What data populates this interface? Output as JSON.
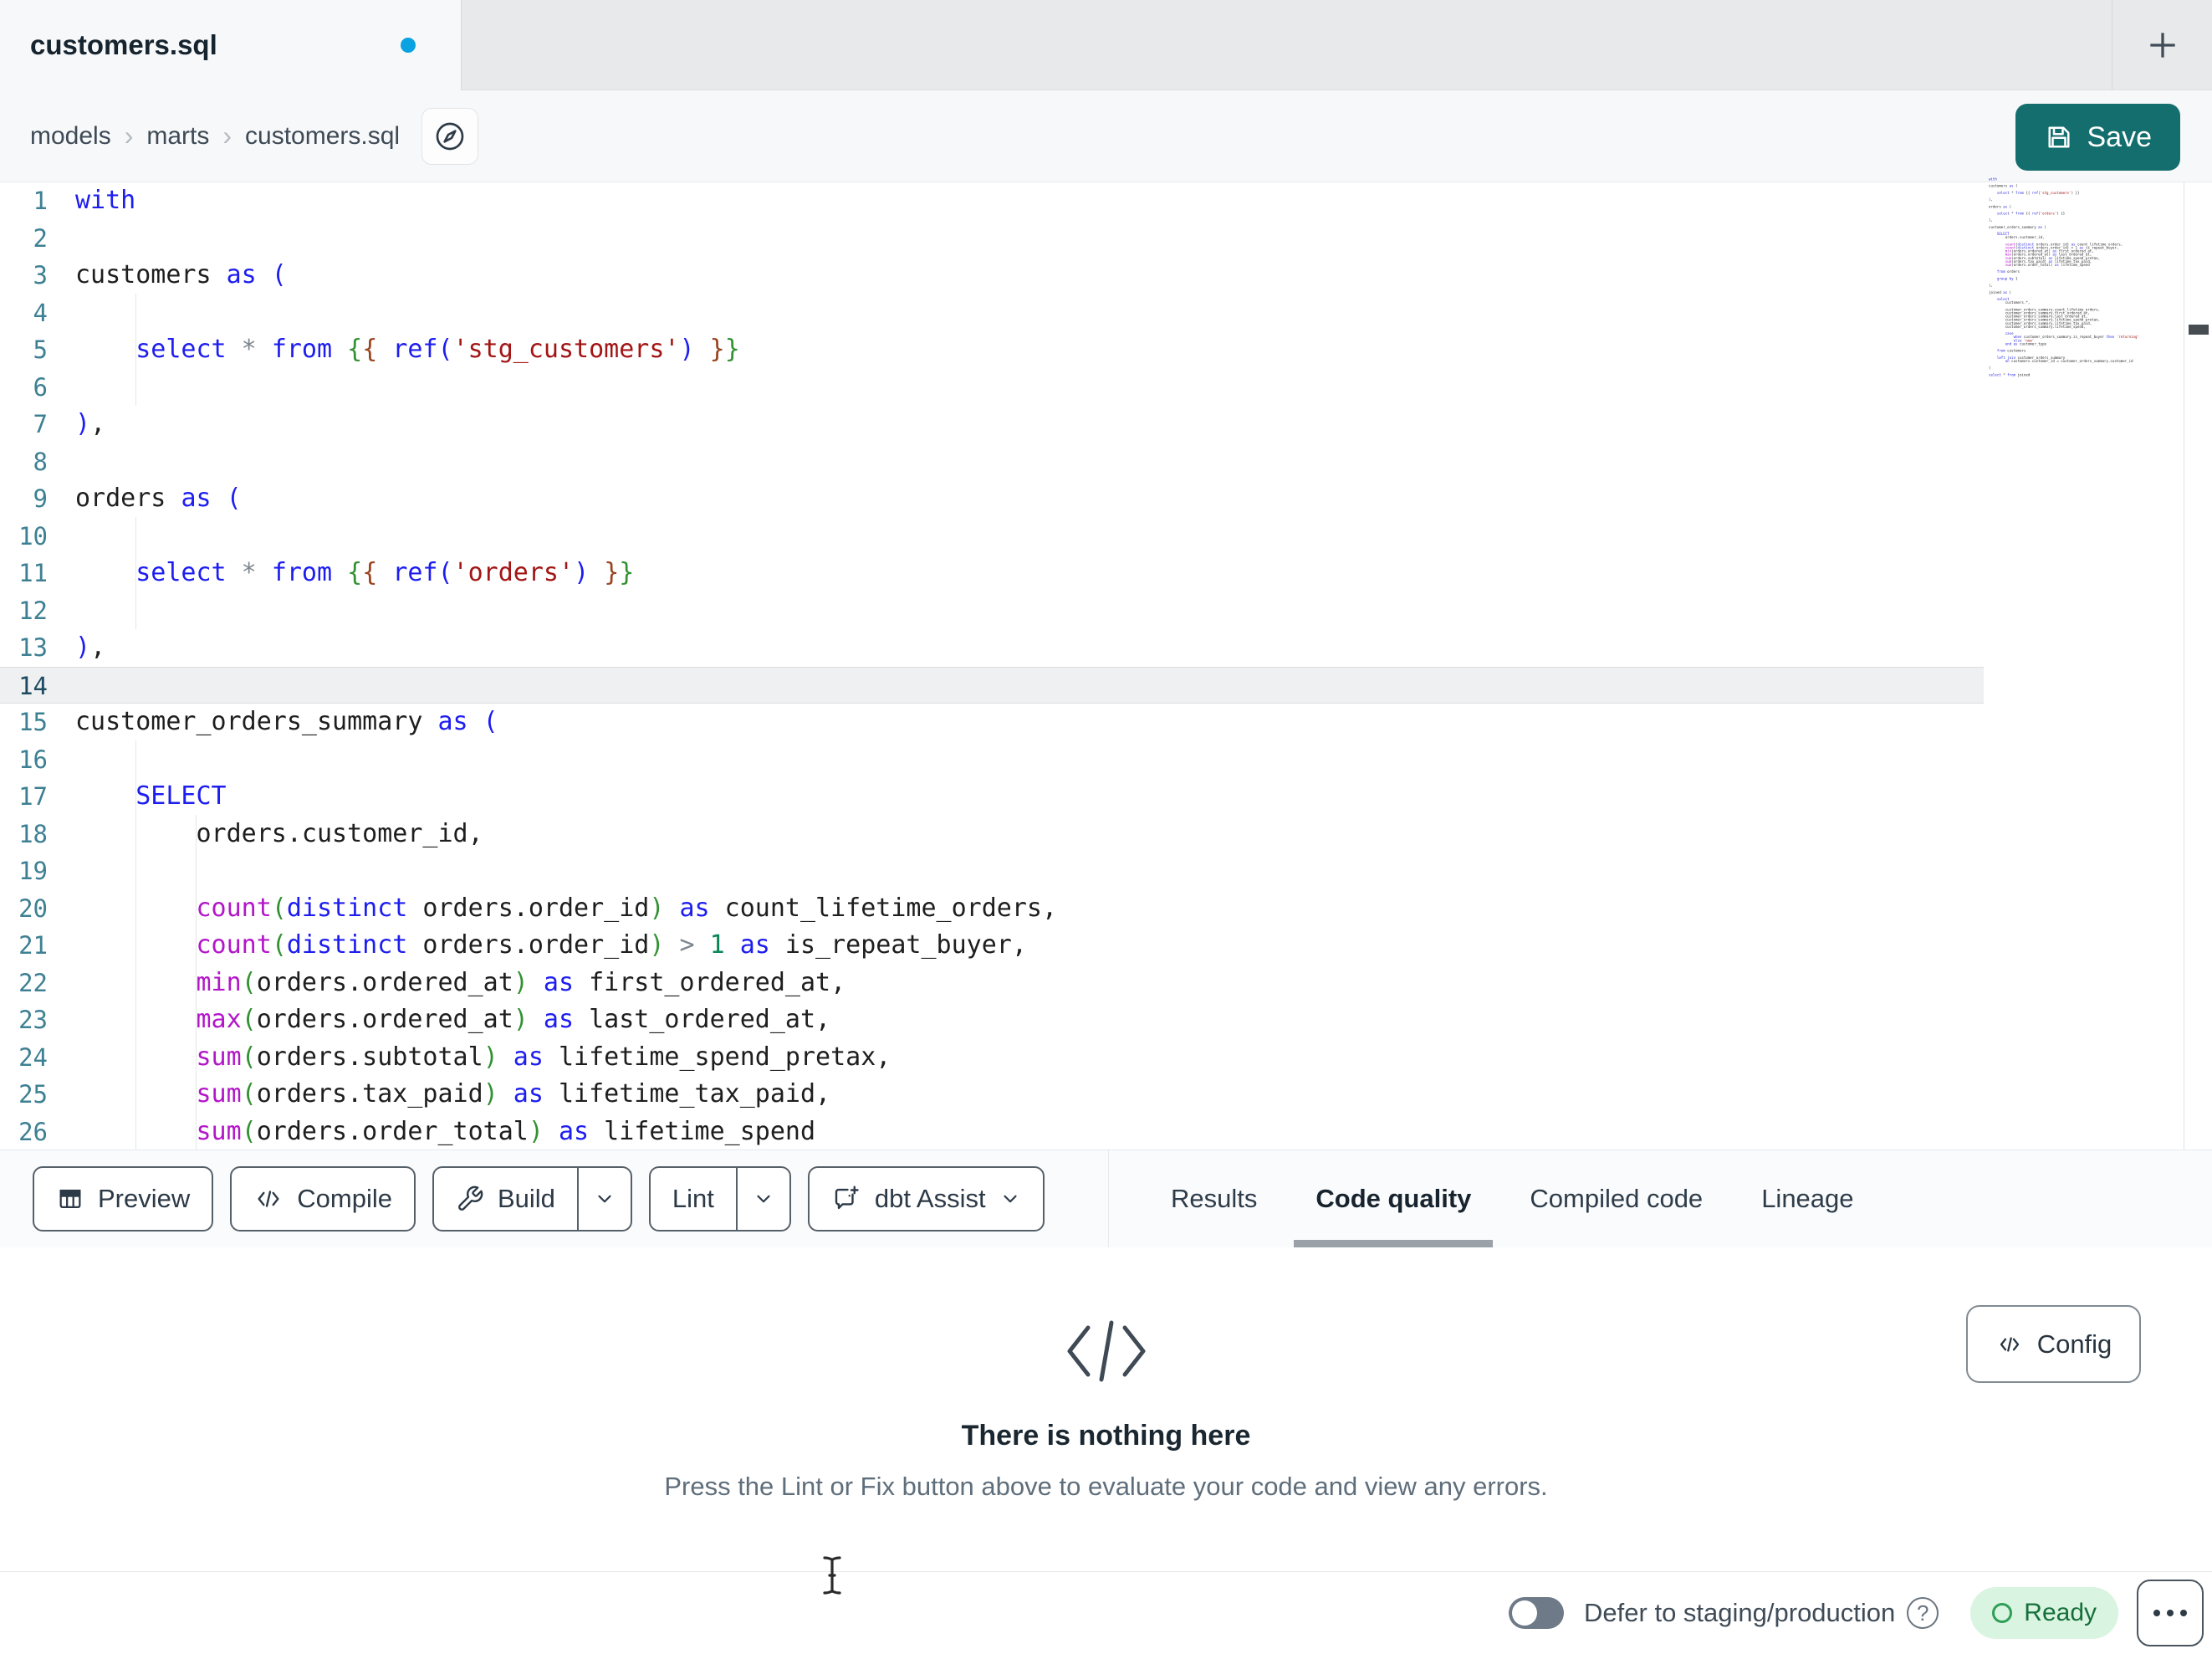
{
  "tab": {
    "title": "customers.sql",
    "modified": true
  },
  "breadcrumb": {
    "items": [
      "models",
      "marts",
      "customers.sql"
    ],
    "separator": "›"
  },
  "save": {
    "label": "Save"
  },
  "editor": {
    "active_line": 14,
    "lines": [
      {
        "n": 1,
        "tokens": [
          [
            "kw",
            "with"
          ]
        ]
      },
      {
        "n": 2,
        "tokens": []
      },
      {
        "n": 3,
        "tokens": [
          [
            "id",
            "customers "
          ],
          [
            "kw",
            "as"
          ],
          [
            "kw",
            " ("
          ]
        ]
      },
      {
        "n": 4,
        "tokens": []
      },
      {
        "n": 5,
        "tokens": [
          [
            "id",
            "    "
          ],
          [
            "kw",
            "select"
          ],
          [
            "op",
            " * "
          ],
          [
            "kw",
            "from"
          ],
          [
            "id",
            " "
          ],
          [
            "j1",
            "{"
          ],
          [
            "j2",
            "{"
          ],
          [
            "id",
            " "
          ],
          [
            "kw",
            "ref("
          ],
          [
            "str",
            "'stg_customers'"
          ],
          [
            "kw",
            ")"
          ],
          [
            "id",
            " "
          ],
          [
            "j2",
            "}"
          ],
          [
            "j1",
            "}"
          ]
        ]
      },
      {
        "n": 6,
        "tokens": []
      },
      {
        "n": 7,
        "tokens": [
          [
            "kw",
            ")"
          ],
          [
            "id",
            ","
          ]
        ]
      },
      {
        "n": 8,
        "tokens": []
      },
      {
        "n": 9,
        "tokens": [
          [
            "id",
            "orders "
          ],
          [
            "kw",
            "as"
          ],
          [
            "kw",
            " ("
          ]
        ]
      },
      {
        "n": 10,
        "tokens": []
      },
      {
        "n": 11,
        "tokens": [
          [
            "id",
            "    "
          ],
          [
            "kw",
            "select"
          ],
          [
            "op",
            " * "
          ],
          [
            "kw",
            "from"
          ],
          [
            "id",
            " "
          ],
          [
            "j1",
            "{"
          ],
          [
            "j2",
            "{"
          ],
          [
            "id",
            " "
          ],
          [
            "kw",
            "ref("
          ],
          [
            "str",
            "'orders'"
          ],
          [
            "kw",
            ")"
          ],
          [
            "id",
            " "
          ],
          [
            "j2",
            "}"
          ],
          [
            "j1",
            "}"
          ]
        ]
      },
      {
        "n": 12,
        "tokens": []
      },
      {
        "n": 13,
        "tokens": [
          [
            "kw",
            ")"
          ],
          [
            "id",
            ","
          ]
        ]
      },
      {
        "n": 14,
        "tokens": []
      },
      {
        "n": 15,
        "tokens": [
          [
            "id",
            "customer_orders_summary "
          ],
          [
            "kw",
            "as"
          ],
          [
            "kw",
            " ("
          ]
        ]
      },
      {
        "n": 16,
        "tokens": []
      },
      {
        "n": 17,
        "tokens": [
          [
            "id",
            "    "
          ],
          [
            "kw",
            "SELECT"
          ]
        ]
      },
      {
        "n": 18,
        "tokens": [
          [
            "id",
            "        orders.customer_id,"
          ]
        ]
      },
      {
        "n": 19,
        "tokens": []
      },
      {
        "n": 20,
        "tokens": [
          [
            "id",
            "        "
          ],
          [
            "fn",
            "count"
          ],
          [
            "par",
            "("
          ],
          [
            "kw",
            "distinct"
          ],
          [
            "id",
            " orders.order_id"
          ],
          [
            "par",
            ")"
          ],
          [
            "kw",
            " as"
          ],
          [
            "id",
            " count_lifetime_orders,"
          ]
        ]
      },
      {
        "n": 21,
        "tokens": [
          [
            "id",
            "        "
          ],
          [
            "fn",
            "count"
          ],
          [
            "par",
            "("
          ],
          [
            "kw",
            "distinct"
          ],
          [
            "id",
            " orders.order_id"
          ],
          [
            "par",
            ")"
          ],
          [
            "op",
            " > "
          ],
          [
            "num",
            "1"
          ],
          [
            "kw",
            " as"
          ],
          [
            "id",
            " is_repeat_buyer,"
          ]
        ]
      },
      {
        "n": 22,
        "tokens": [
          [
            "id",
            "        "
          ],
          [
            "fn",
            "min"
          ],
          [
            "par",
            "("
          ],
          [
            "id",
            "orders.ordered_at"
          ],
          [
            "par",
            ")"
          ],
          [
            "kw",
            " as"
          ],
          [
            "id",
            " first_ordered_at,"
          ]
        ]
      },
      {
        "n": 23,
        "tokens": [
          [
            "id",
            "        "
          ],
          [
            "fn",
            "max"
          ],
          [
            "par",
            "("
          ],
          [
            "id",
            "orders.ordered_at"
          ],
          [
            "par",
            ")"
          ],
          [
            "kw",
            " as"
          ],
          [
            "id",
            " last_ordered_at,"
          ]
        ]
      },
      {
        "n": 24,
        "tokens": [
          [
            "id",
            "        "
          ],
          [
            "fn",
            "sum"
          ],
          [
            "par",
            "("
          ],
          [
            "id",
            "orders.subtotal"
          ],
          [
            "par",
            ")"
          ],
          [
            "kw",
            " as"
          ],
          [
            "id",
            " lifetime_spend_pretax,"
          ]
        ]
      },
      {
        "n": 25,
        "tokens": [
          [
            "id",
            "        "
          ],
          [
            "fn",
            "sum"
          ],
          [
            "par",
            "("
          ],
          [
            "id",
            "orders.tax_paid"
          ],
          [
            "par",
            ")"
          ],
          [
            "kw",
            " as"
          ],
          [
            "id",
            " lifetime_tax_paid,"
          ]
        ]
      },
      {
        "n": 26,
        "tokens": [
          [
            "id",
            "        "
          ],
          [
            "fn",
            "sum"
          ],
          [
            "par",
            "("
          ],
          [
            "id",
            "orders.order_total"
          ],
          [
            "par",
            ")"
          ],
          [
            "kw",
            " as"
          ],
          [
            "id",
            " lifetime_spend"
          ]
        ]
      }
    ],
    "minimap": {
      "extra_lines": [
        "",
        "    from orders",
        "",
        "    group by 1",
        "",
        "),",
        "",
        "joined as (",
        "",
        "    select",
        "        customers.*,",
        "",
        "        customer_orders_summary.count_lifetime_orders,",
        "        customer_orders_summary.first_ordered_at,",
        "        customer_orders_summary.last_ordered_at,",
        "        customer_orders_summary.lifetime_spend_pretax,",
        "        customer_orders_summary.lifetime_tax_paid,",
        "        customer_orders_summary.lifetime_spend,",
        "",
        "        case",
        "            when customer_orders_summary.is_repeat_buyer then 'returning'",
        "            else 'new'",
        "        end as customer_type",
        "",
        "    from customers",
        "",
        "    left join customer_orders_summary",
        "        on customers.customer_id = customer_orders_summary.customer_id",
        "",
        ")",
        "",
        "select * from joined"
      ]
    }
  },
  "toolbar": {
    "preview": {
      "label": "Preview"
    },
    "compile": {
      "label": "Compile"
    },
    "build": {
      "label": "Build",
      "has_menu": true
    },
    "lint": {
      "label": "Lint",
      "has_menu": true
    },
    "assist": {
      "label": "dbt Assist",
      "has_menu": true
    }
  },
  "tabs": {
    "items": [
      {
        "label": "Results",
        "active": false
      },
      {
        "label": "Code quality",
        "active": true
      },
      {
        "label": "Compiled code",
        "active": false
      },
      {
        "label": "Lineage",
        "active": false
      }
    ]
  },
  "panel": {
    "title": "There is nothing here",
    "subtitle": "Press the Lint or Fix button above to evaluate your code and view any errors.",
    "config": {
      "label": "Config"
    }
  },
  "statusbar": {
    "defer": {
      "label": "Defer to staging/production",
      "enabled": false
    },
    "status": {
      "label": "Ready"
    }
  },
  "icons": {
    "tab_indicator": "unsaved-dot",
    "new_tab": "plus-icon",
    "breadcrumb_action": "compass-icon",
    "save": "floppy-icon",
    "preview": "table-grid-icon",
    "compile": "code-icon",
    "build": "wrench-icon",
    "assist": "chat-sparkle-icon",
    "dropdown": "chevron-down-icon",
    "empty_state": "code-icon",
    "config": "code-icon",
    "help": "question-circle-icon",
    "status": "circle-outline-icon",
    "menu": "ellipsis-icon",
    "mouse": "text-cursor-icon"
  },
  "colors": {
    "accent_teal": "#146e6e",
    "unsaved_dot_blue": "#0aa2e0",
    "ready_bg": "#d9f4e0",
    "ready_text": "#17703c",
    "active_tab_underline": "#9aa1a8",
    "syntax_keyword": "#1d1df0",
    "syntax_function": "#b316c9",
    "syntax_paren": "#339133",
    "syntax_string": "#a31515",
    "syntax_number": "#098658",
    "line_number": "#3e8093"
  }
}
